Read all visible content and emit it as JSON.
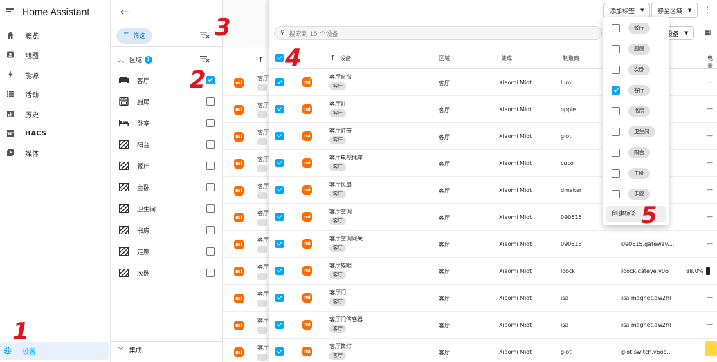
{
  "app": {
    "title": "Home Assistant"
  },
  "sidebar": {
    "items": [
      {
        "label": "概览",
        "icon": "home-icon"
      },
      {
        "label": "地图",
        "icon": "map-icon"
      },
      {
        "label": "能源",
        "icon": "energy-icon"
      },
      {
        "label": "活动",
        "icon": "list-icon"
      },
      {
        "label": "历史",
        "icon": "chart-icon"
      },
      {
        "label": "HACS",
        "icon": "hacs-icon"
      },
      {
        "label": "媒体",
        "icon": "media-icon"
      }
    ],
    "settings_label": "设置"
  },
  "filter_panel": {
    "filter_button": "筛选",
    "area_title": "区域",
    "area_badge": "1",
    "areas": [
      {
        "label": "客厅",
        "checked": true
      },
      {
        "label": "厨房",
        "checked": false
      },
      {
        "label": "卧室",
        "checked": false
      },
      {
        "label": "阳台",
        "checked": false
      },
      {
        "label": "餐厅",
        "checked": false
      },
      {
        "label": "主卧",
        "checked": false
      },
      {
        "label": "卫生间",
        "checked": false
      },
      {
        "label": "书房",
        "checked": false
      },
      {
        "label": "走廊",
        "checked": false
      },
      {
        "label": "次卧",
        "checked": false
      }
    ],
    "integration_title": "集成"
  },
  "under_column": {
    "row_text": "客厅",
    "icon_text": "mi"
  },
  "toolbar": {
    "add_tag": "添加标签",
    "move_area": "移至区域",
    "device_label": "设备"
  },
  "search": {
    "placeholder": "搜索到 15 个设备"
  },
  "table": {
    "headers": {
      "device": "设备",
      "area": "区域",
      "integration": "集成",
      "manufacturer": "制造商",
      "battery": "电量"
    },
    "rows": [
      {
        "name": "客厅窗帘",
        "tag": "客厅",
        "area": "客厅",
        "integration": "Xiaomi Miot",
        "manufacturer": "lumi",
        "model": "",
        "battery": "—"
      },
      {
        "name": "客厅灯",
        "tag": "客厅",
        "area": "客厅",
        "integration": "Xiaomi Miot",
        "manufacturer": "opple",
        "model": "",
        "battery": "—"
      },
      {
        "name": "客厅灯带",
        "tag": "客厅",
        "area": "客厅",
        "integration": "Xiaomi Miot",
        "manufacturer": "giot",
        "model": "",
        "battery": "—"
      },
      {
        "name": "客厅电视插座",
        "tag": "客厅",
        "area": "客厅",
        "integration": "Xiaomi Miot",
        "manufacturer": "cuco",
        "model": "",
        "battery": "—"
      },
      {
        "name": "客厅风扇",
        "tag": "客厅",
        "area": "客厅",
        "integration": "Xiaomi Miot",
        "manufacturer": "dmaker",
        "model": "",
        "battery": "—"
      },
      {
        "name": "客厅空调",
        "tag": "客厅",
        "area": "客厅",
        "integration": "Xiaomi Miot",
        "manufacturer": "090615",
        "model": "",
        "battery": "—"
      },
      {
        "name": "客厅空调网关",
        "tag": "客厅",
        "area": "客厅",
        "integration": "Xiaomi Miot",
        "manufacturer": "090615",
        "model": "090615.gateway....",
        "battery": "—"
      },
      {
        "name": "客厅猫眼",
        "tag": "客厅",
        "area": "客厅",
        "integration": "Xiaomi Miot",
        "manufacturer": "loock",
        "model": "loock.cateye.v06",
        "battery": "88.0%"
      },
      {
        "name": "客厅门",
        "tag": "客厅",
        "area": "客厅",
        "integration": "Xiaomi Miot",
        "manufacturer": "isa",
        "model": "isa.magnet.dw2hl",
        "battery": "—"
      },
      {
        "name": "客厅门传感器",
        "tag": "客厅",
        "area": "客厅",
        "integration": "Xiaomi Miot",
        "manufacturer": "isa",
        "model": "isa.magnet.dw2hl",
        "battery": "—"
      },
      {
        "name": "客厅筒灯",
        "tag": "客厅",
        "area": "客厅",
        "integration": "Xiaomi Miot",
        "manufacturer": "giot",
        "model": "giot.switch.v6oo...",
        "battery": "—"
      }
    ]
  },
  "tag_menu": {
    "items": [
      {
        "label": "餐厅",
        "checked": false
      },
      {
        "label": "厨房",
        "checked": false
      },
      {
        "label": "次卧",
        "checked": false
      },
      {
        "label": "客厅",
        "checked": true
      },
      {
        "label": "书房",
        "checked": false
      },
      {
        "label": "卫生间",
        "checked": false
      },
      {
        "label": "阳台",
        "checked": false
      },
      {
        "label": "主卧",
        "checked": false
      },
      {
        "label": "走廊",
        "checked": false
      }
    ],
    "create_label": "创建标签"
  },
  "annotations": [
    "1",
    "2",
    "3",
    "4",
    "5"
  ],
  "colors": {
    "accent": "#03a9f4",
    "mi_orange": "#ff6900",
    "annotation_red": "#e0141e"
  }
}
